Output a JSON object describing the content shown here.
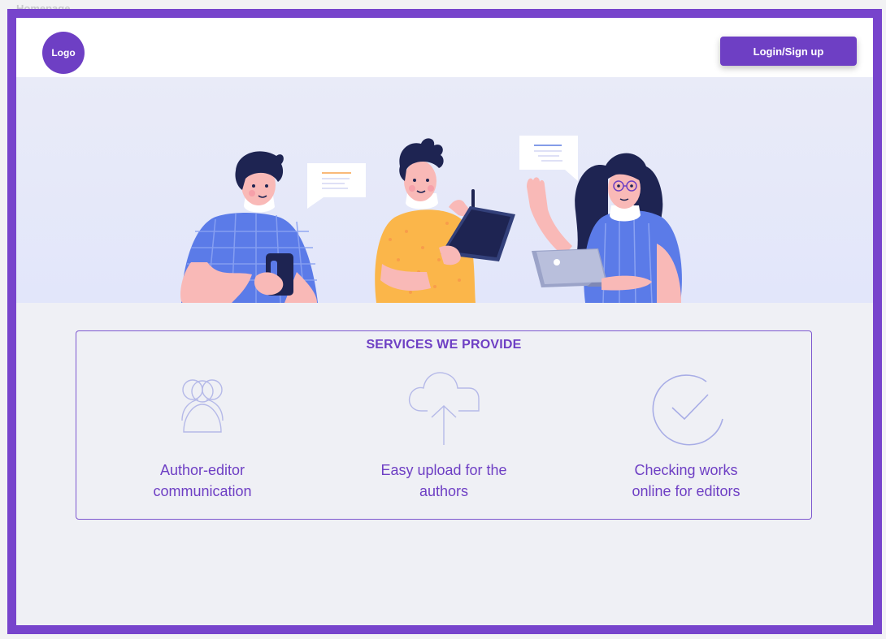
{
  "frame": {
    "label": "Homepage"
  },
  "header": {
    "logo_text": "Logo",
    "login_label": "Login/Sign up"
  },
  "services": {
    "title": "SERVICES WE PROVIDE",
    "items": [
      {
        "line1": "Author-editor",
        "line2": "communication",
        "icon": "users-icon"
      },
      {
        "line1": "Easy upload for the",
        "line2": "authors",
        "icon": "cloud-upload-icon"
      },
      {
        "line1": "Checking works",
        "line2": "online for editors",
        "icon": "checkmark-circle-icon"
      }
    ]
  },
  "colors": {
    "brand": "#6e3fc4",
    "frame": "#7744cc",
    "hero_bg": "#e4e7fa",
    "background": "#eff0f5"
  }
}
